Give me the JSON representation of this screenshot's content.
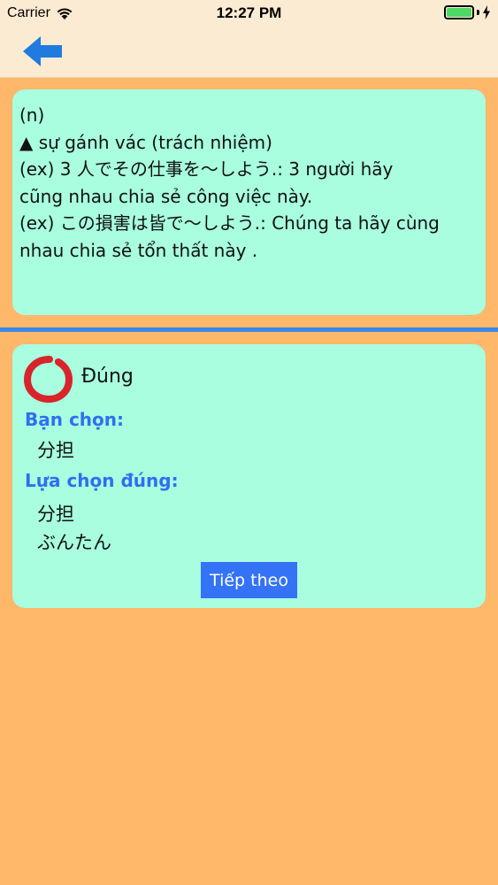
{
  "status_bar": {
    "carrier": "Carrier",
    "time": "12:27 PM",
    "battery_level": 1.0
  },
  "nav": {
    "back_icon": "arrow-left-icon",
    "accent_color": "#1f7be0"
  },
  "definition": {
    "text": "(n)\n▲ sự gánh vác (trách nhiệm)\n(ex) 3 人でその仕事を～しよう.: 3 người hãy\ncũng nhau chia sẻ công việc này.\n(ex) この損害は皆で～しよう.: Chúng ta hãy cùng\nnhau chia sẻ tổn thất này ."
  },
  "result": {
    "icon": "enso-circle-icon",
    "status": "Đúng",
    "chosen_label": "Bạn chọn:",
    "chosen_answer": "分担",
    "correct_label": "Lựa chọn đúng:",
    "correct_kanji": "分担",
    "correct_kana": "ぶんたん",
    "next_label": "Tiếp theo"
  },
  "colors": {
    "background": "#ffb76a",
    "header": "#fcebd3",
    "card": "#a8fedf",
    "divider": "#3a8ae6",
    "label": "#2f6ff0",
    "button": "#3472f6",
    "enso": "#d8242b"
  }
}
